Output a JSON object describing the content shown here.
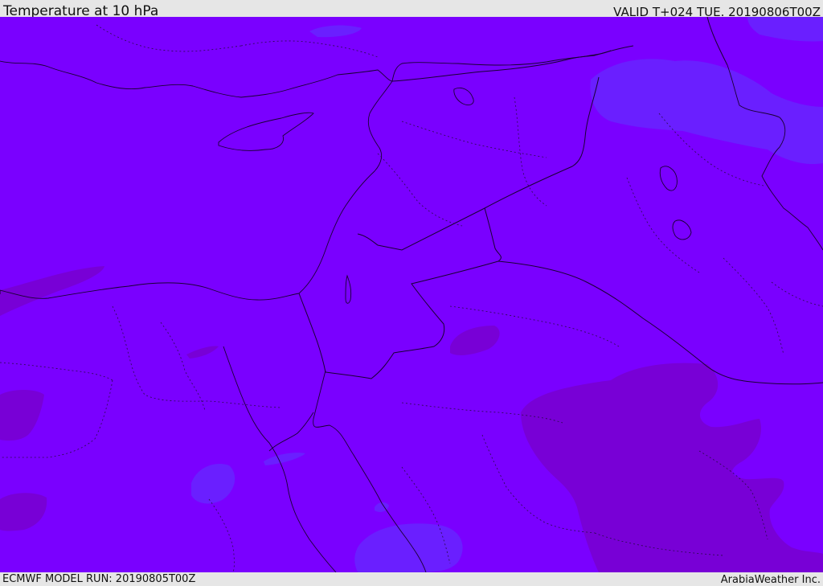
{
  "header": {
    "title": "Temperature at 10 hPa",
    "valid": "VALID T+024 TUE. 20190806T00Z"
  },
  "footer": {
    "model_run": "ECMWF MODEL RUN: 20190805T00Z",
    "brand": "ArabiaWeather Inc."
  },
  "map": {
    "base_color": "#7a00ff",
    "colors": {
      "cooler_band": "#6a1fff",
      "warmer_band": "#7800d6",
      "boundaries": "#1a0033"
    }
  }
}
